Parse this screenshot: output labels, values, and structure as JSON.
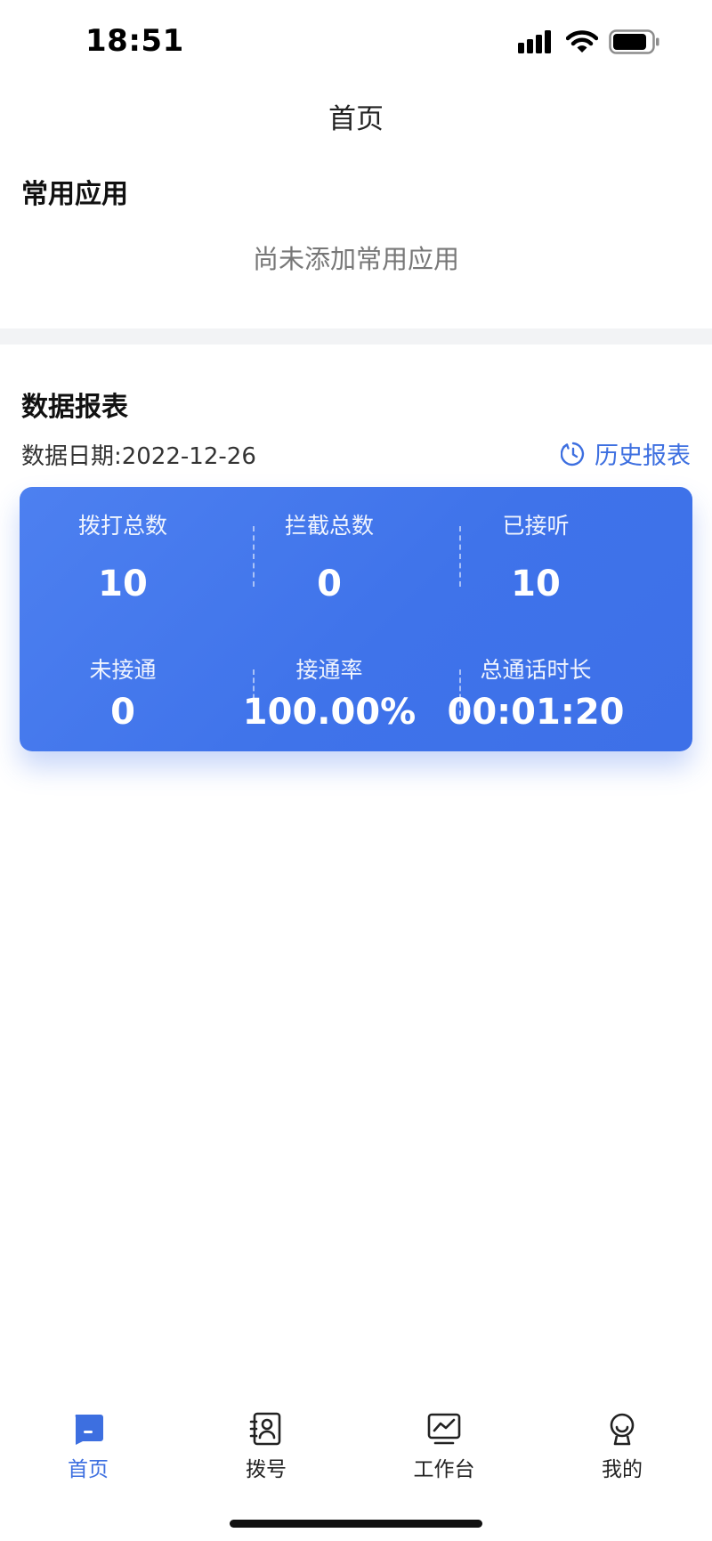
{
  "status_bar": {
    "time": "18:51",
    "icons": [
      "signal-icon",
      "wifi-icon",
      "battery-icon"
    ]
  },
  "nav": {
    "title": "首页"
  },
  "frequent_apps": {
    "heading": "常用应用",
    "empty_text": "尚未添加常用应用"
  },
  "report": {
    "heading": "数据报表",
    "date_text": "数据日期:2022-12-26",
    "history_link": "历史报表",
    "history_icon": "clock-icon",
    "stats": [
      {
        "label": "拨打总数",
        "value": "10"
      },
      {
        "label": "拦截总数",
        "value": "0"
      },
      {
        "label": "已接听",
        "value": "10"
      },
      {
        "label": "未接通",
        "value": "0"
      },
      {
        "label": "接通率",
        "value": "100.00%"
      },
      {
        "label": "总通话时长",
        "value": "00:01:20"
      }
    ]
  },
  "tabbar": {
    "items": [
      {
        "label": "首页",
        "icon": "home-icon",
        "active": true
      },
      {
        "label": "拨号",
        "icon": "contacts-icon",
        "active": false
      },
      {
        "label": "工作台",
        "icon": "chart-icon",
        "active": false
      },
      {
        "label": "我的",
        "icon": "profile-icon",
        "active": false
      }
    ]
  },
  "colors": {
    "accent": "#3d6fe0",
    "card_background": "#4477ec",
    "divider_background": "#f2f3f5"
  }
}
